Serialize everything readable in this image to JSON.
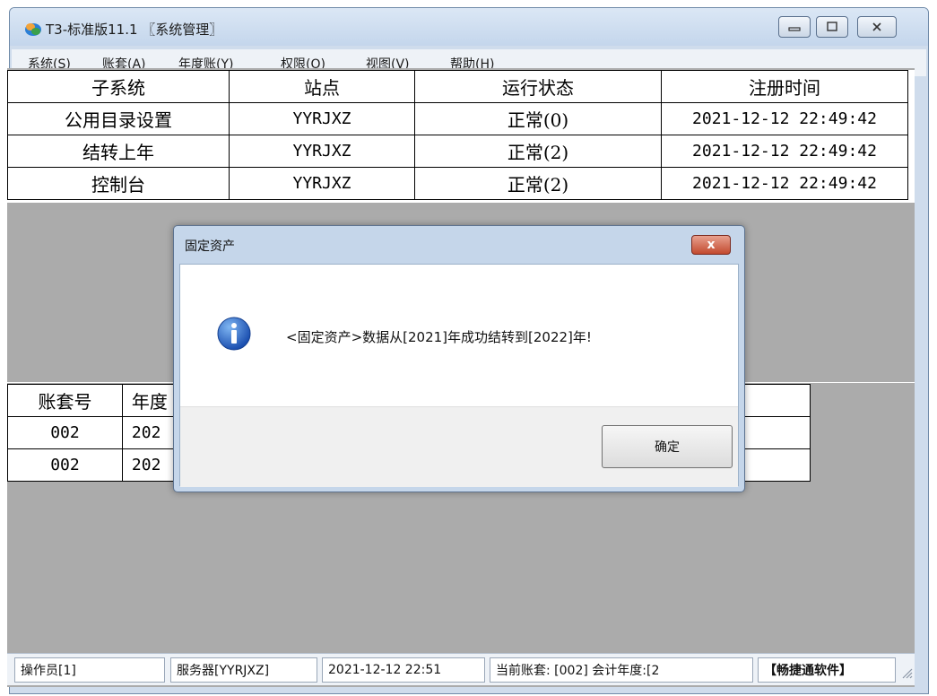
{
  "window": {
    "title": "T3-标准版11.1 〖系统管理〗",
    "minimize_icon": "minimize-icon",
    "maximize_icon": "maximize-icon",
    "close_icon": "close-icon"
  },
  "menu": {
    "items": [
      {
        "label": "系统(S)"
      },
      {
        "label": "账套(A)"
      },
      {
        "label": "年度账(Y)"
      },
      {
        "label": "权限(O)"
      },
      {
        "label": "视图(V)"
      },
      {
        "label": "帮助(H)"
      }
    ]
  },
  "subsystem_table": {
    "headers": [
      "子系统",
      "站点",
      "运行状态",
      "注册时间"
    ],
    "rows": [
      [
        "公用目录设置",
        "YYRJXZ",
        "正常(0)",
        "2021-12-12 22:49:42"
      ],
      [
        "结转上年",
        "YYRJXZ",
        "正常(2)",
        "2021-12-12 22:49:42"
      ],
      [
        "控制台",
        "YYRJXZ",
        "正常(2)",
        "2021-12-12 22:49:42"
      ]
    ]
  },
  "account_table": {
    "headers": [
      "账套号",
      "年度"
    ],
    "rows": [
      [
        "002",
        "202"
      ],
      [
        "002",
        "202"
      ]
    ]
  },
  "dialog": {
    "title": "固定资产",
    "message": "<固定资产>数据从[2021]年成功结转到[2022]年!",
    "ok_label": "确定",
    "close_label": "x"
  },
  "status": {
    "operator": "操作员[1]",
    "server": "服务器[YYRJXZ]",
    "datetime": "2021-12-12 22:51",
    "account_info": "当前账套: [002] 会计年度:[2",
    "brand": "【畅捷通软件】"
  },
  "colors": {
    "client_bg": "#ababab",
    "titlebar": "#c4d6ec",
    "dialog_close": "#c24a2f"
  }
}
